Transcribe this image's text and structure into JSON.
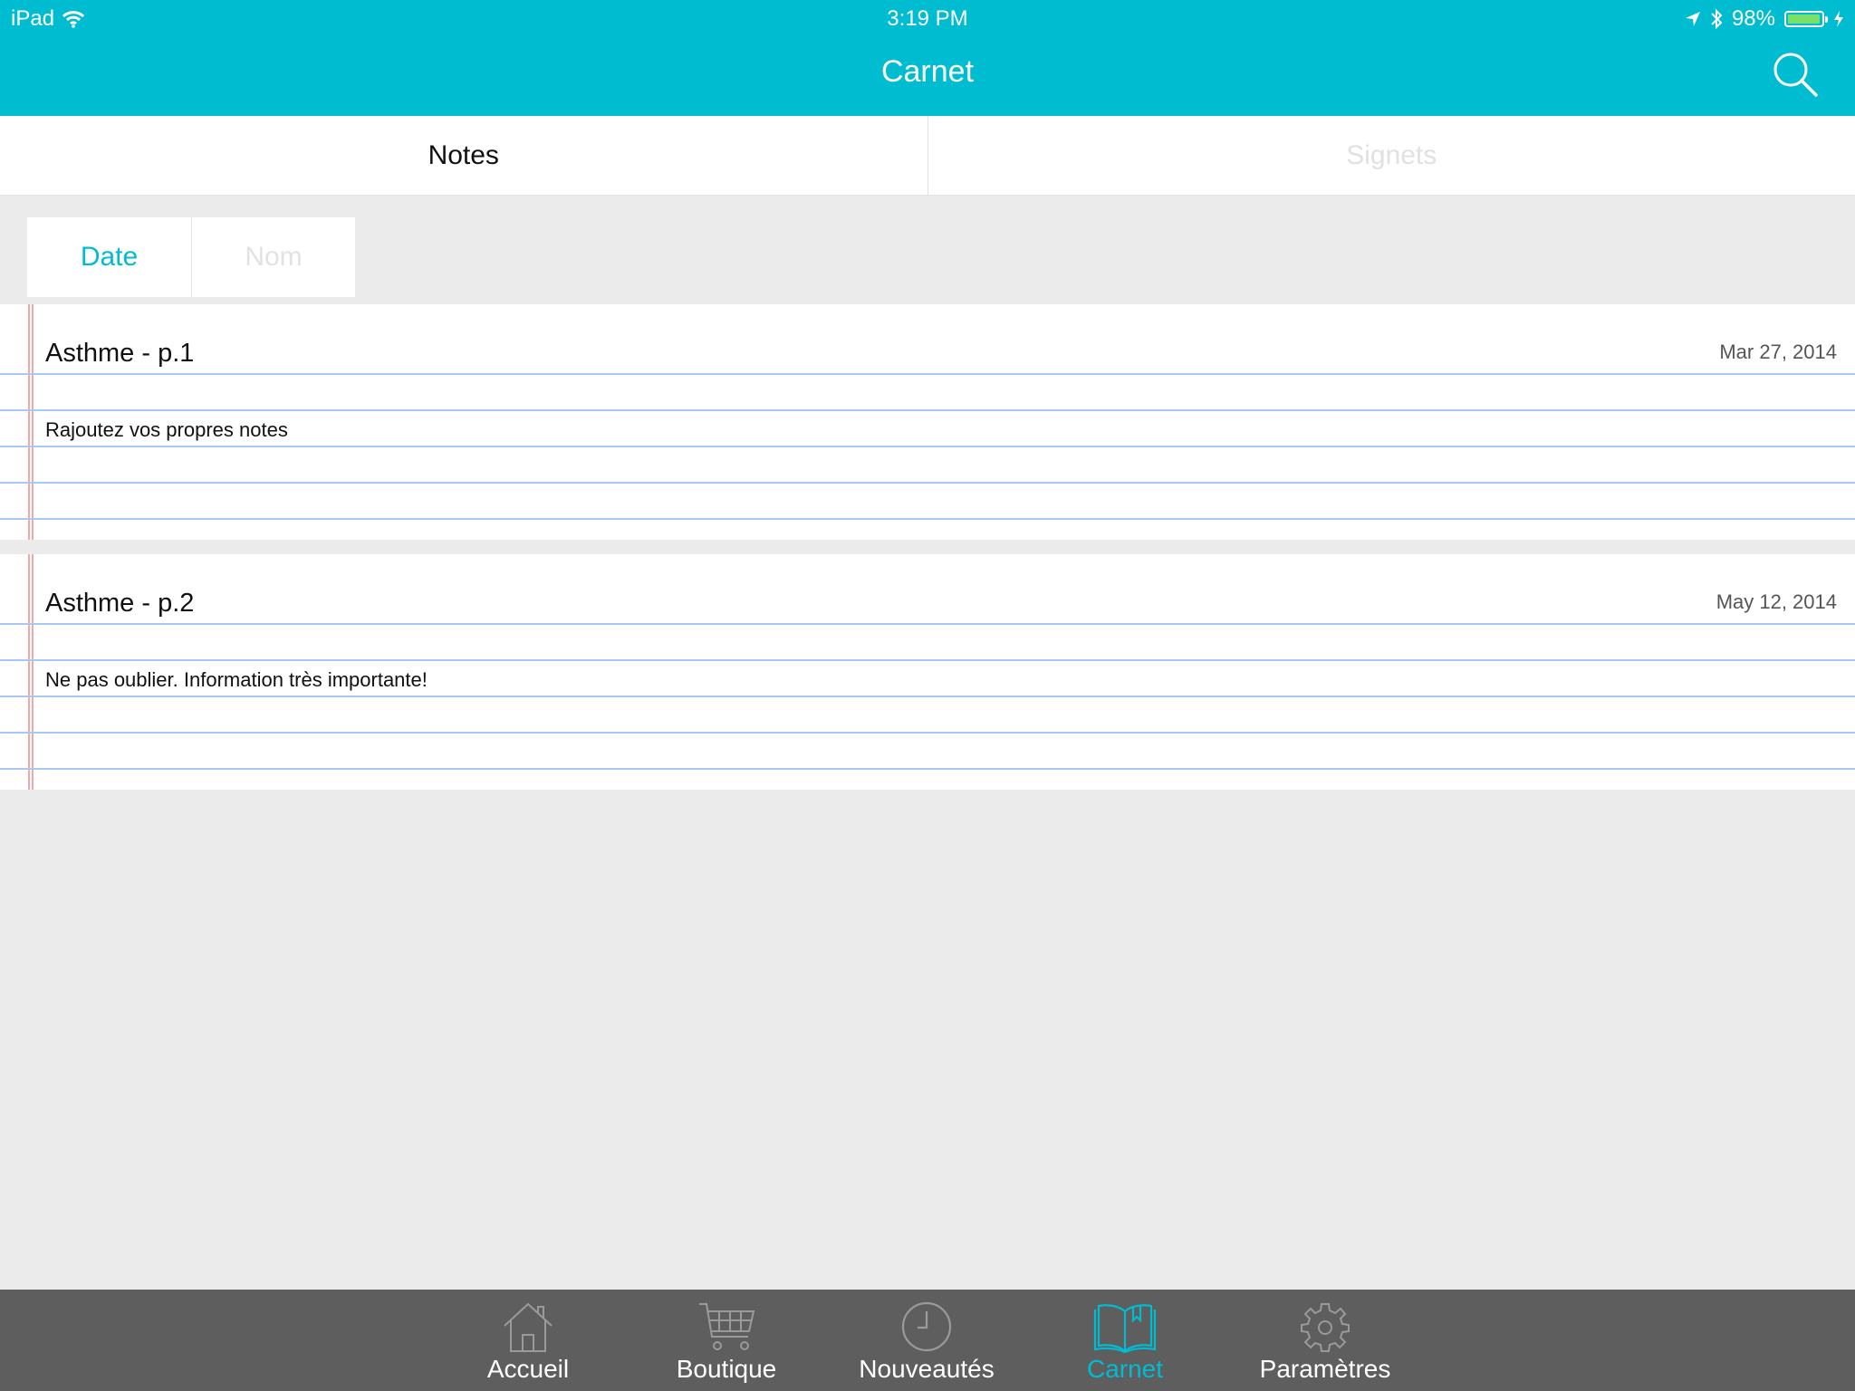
{
  "status_bar": {
    "device": "iPad",
    "time": "3:19 PM",
    "battery": "98%",
    "battery_level": 0.98
  },
  "header": {
    "title": "Carnet"
  },
  "segments": [
    {
      "label": "Notes",
      "active": true
    },
    {
      "label": "Signets",
      "active": false
    }
  ],
  "sort": [
    {
      "label": "Date",
      "active": true
    },
    {
      "label": "Nom",
      "active": false
    }
  ],
  "notes": [
    {
      "title": "Asthme - p.1",
      "date": "Mar 27, 2014",
      "body": "Rajoutez vos propres notes"
    },
    {
      "title": "Asthme - p.2",
      "date": "May 12, 2014",
      "body": "Ne pas oublier. Information très importante!"
    }
  ],
  "tabbar": [
    {
      "label": "Accueil",
      "icon": "house-icon",
      "active": false
    },
    {
      "label": "Boutique",
      "icon": "cart-icon",
      "active": false
    },
    {
      "label": "Nouveautés",
      "icon": "clock-icon",
      "active": false
    },
    {
      "label": "Carnet",
      "icon": "open-book-icon",
      "active": true
    },
    {
      "label": "Paramètres",
      "icon": "gear-icon",
      "active": false
    }
  ],
  "colors": {
    "accent": "#00bcd1",
    "tabbar": "#5e5e5e",
    "background": "#ebebeb",
    "ruled_line": "#a9c9f0",
    "margin_line": "#f3a6a6"
  }
}
